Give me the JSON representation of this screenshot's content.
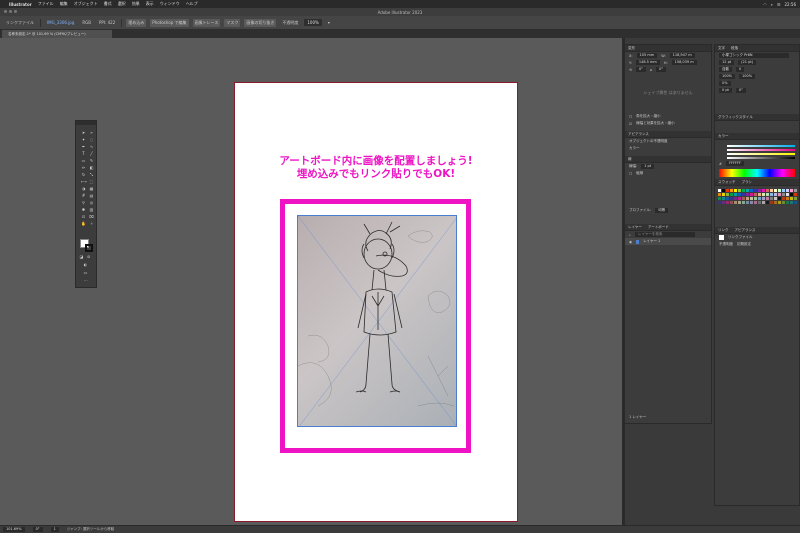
{
  "menubar": {
    "app_name": "Illustrator",
    "items": [
      "ファイル",
      "編集",
      "オブジェクト",
      "書式",
      "選択",
      "効果",
      "表示",
      "ウィンドウ",
      "ヘルプ"
    ],
    "clock": "22:56"
  },
  "window": {
    "title": "Adobe Illustrator 2023"
  },
  "control_bar": {
    "link_file": "リンクファイル",
    "file_name": "IMG_3306.jpg",
    "color_mode": "RGB",
    "ppi": "PPI: 422",
    "embed": "埋め込み",
    "edit_original": "Photoshop で編集",
    "image_trace": "画像トレース",
    "mask": "マスク",
    "crop": "画像の切り抜き",
    "opacity_label": "不透明度",
    "opacity_value": "100%"
  },
  "doc_tab": {
    "label": "名称未設定-1* @ 101.69 % (CMYK/プレビュー)"
  },
  "artboard": {
    "headline_line1": "アートボード内に画像を配置しましょう!",
    "headline_line2": "埋め込みでもリンク貼りでもOK!"
  },
  "status": {
    "zoom": "101.69%",
    "angle": "0°",
    "page": "1",
    "info": "ジャンプ: 選択ツールから移動"
  },
  "panel_properties": {
    "tab": "変形",
    "x_label": "X:",
    "x_value": "105 mm",
    "y_label": "Y:",
    "y_value": "148.5 mm",
    "w_label": "W:",
    "w_value": "118,947 m",
    "h_label": "H:",
    "h_value": "158,039 m",
    "angle": "0°",
    "note": "シェイプ属性 はありません",
    "option1": "角を拡大・縮小",
    "option2": "線幅と効果を拡大・縮小",
    "appearance_tab": "アピアランス",
    "object_label": "オブジェクトの不透明度",
    "color_label": "カラー",
    "stroke_label": "線幅:",
    "stroke_value": "1 pt",
    "stroke_row": "線",
    "dash_label": "破線",
    "profile_label": "プロファイル:",
    "profile_value": "均等"
  },
  "panel_layers": {
    "tab1": "レイヤー",
    "tab2": "アートボード",
    "search_placeholder": "レイヤーを検索",
    "layer1": "レイヤー 1",
    "footer": "1 レイヤー"
  },
  "panel_character": {
    "tab1": "文字",
    "tab2": "段落",
    "font": "小塚ゴシック Pr6N",
    "size": "12 pt",
    "leading": "(21 pt)",
    "tracking": "0",
    "auto": "自動",
    "scale": "100%",
    "zero_pct": "0%",
    "zero_pt": "0 pt"
  },
  "panel_misc": {
    "graphic_style": "グラフィックスタイル",
    "color_tab": "カラー",
    "swatch_tab": "スウォッチ",
    "brush_tab": "ブラシ",
    "link_tab": "リンク",
    "link_file_label": "リンクファイル",
    "link_name": "IMG_3306.jpg",
    "hex_value": "FFFFFF",
    "appearance2": "アピアランス",
    "link_info": "不透明度",
    "link_info2": "初期設定"
  },
  "colors": {
    "accent": "#ee14c4",
    "chrome": "#3c3c3c",
    "canvas": "#5a5a5a"
  }
}
